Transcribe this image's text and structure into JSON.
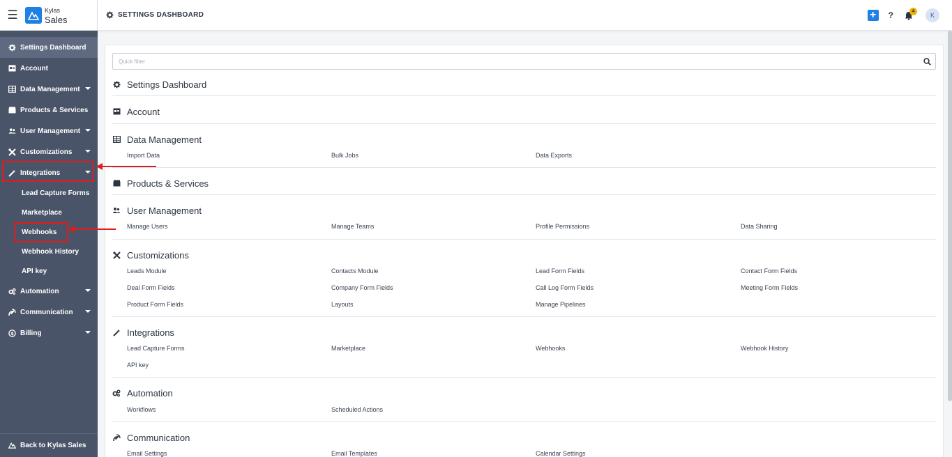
{
  "brand": {
    "line1": "Kylas",
    "line2": "Sales"
  },
  "header": {
    "title": "SETTINGS DASHBOARD",
    "notification_count": "4",
    "avatar_initial": "K",
    "help": "?"
  },
  "sidebar": {
    "items": [
      {
        "label": "Settings Dashboard",
        "icon": "gear-icon"
      },
      {
        "label": "Account",
        "icon": "id-card-icon"
      },
      {
        "label": "Data Management",
        "icon": "table-icon"
      },
      {
        "label": "Products & Services",
        "icon": "box-icon"
      },
      {
        "label": "User Management",
        "icon": "users-icon"
      },
      {
        "label": "Customizations",
        "icon": "tools-icon"
      },
      {
        "label": "Integrations",
        "icon": "magic-wand-icon"
      },
      {
        "label": "Automation",
        "icon": "cogs-icon"
      },
      {
        "label": "Communication",
        "icon": "satellite-icon"
      },
      {
        "label": "Billing",
        "icon": "coin-icon"
      }
    ],
    "integrations_sub": [
      "Lead Capture Forms",
      "Marketplace",
      "Webhooks",
      "Webhook History",
      "API key"
    ],
    "back_label": "Back to Kylas Sales"
  },
  "search": {
    "placeholder": "Quick filter"
  },
  "sections": {
    "settings_dashboard": {
      "title": "Settings Dashboard"
    },
    "account": {
      "title": "Account"
    },
    "data_management": {
      "title": "Data Management",
      "links": [
        "Import Data",
        "Bulk Jobs",
        "Data Exports"
      ]
    },
    "products_services": {
      "title": "Products & Services"
    },
    "user_management": {
      "title": "User Management",
      "links": [
        "Manage Users",
        "Manage Teams",
        "Profile Permissions",
        "Data Sharing"
      ]
    },
    "customizations": {
      "title": "Customizations",
      "links": [
        "Leads Module",
        "Contacts Module",
        "Lead Form Fields",
        "Contact Form Fields",
        "Deal Form Fields",
        "Company Form Fields",
        "Call Log Form Fields",
        "Meeting Form Fields",
        "Product Form Fields",
        "Layouts",
        "Manage Pipelines"
      ]
    },
    "integrations": {
      "title": "Integrations",
      "links": [
        "Lead Capture Forms",
        "Marketplace",
        "Webhooks",
        "Webhook History",
        "API key"
      ]
    },
    "automation": {
      "title": "Automation",
      "links": [
        "Workflows",
        "Scheduled Actions"
      ]
    },
    "communication": {
      "title": "Communication",
      "links": [
        "Email Settings",
        "Email Templates",
        "Calendar Settings"
      ]
    }
  },
  "colors": {
    "sidebar_bg": "#4a5468",
    "accent": "#1e7fe5",
    "annotation": "#e21b1b",
    "badge": "#f0b400"
  }
}
